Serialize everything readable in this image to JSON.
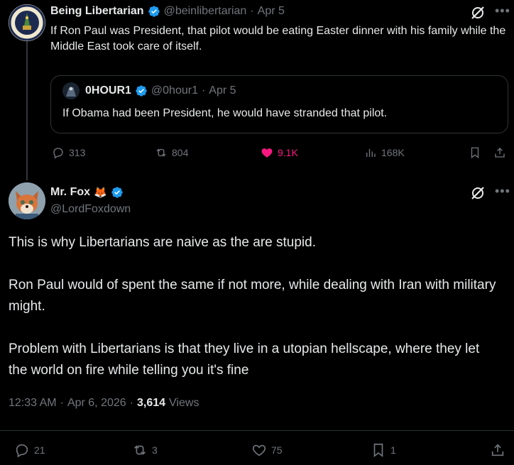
{
  "tweet1": {
    "name": "Being Libertarian",
    "handle": "@beinlibertarian",
    "sep": "·",
    "date": "Apr 5",
    "text": "If Ron Paul was President, that pilot would be eating Easter dinner with his family while the Middle East took care of itself.",
    "quote": {
      "name": "0HOUR1",
      "handle": "@0hour1",
      "sep": "·",
      "date": "Apr 5",
      "text": "If Obama had been President, he would have stranded that pilot."
    },
    "actions": {
      "replies": "313",
      "reposts": "804",
      "likes": "9.1K",
      "views": "168K"
    }
  },
  "tweet2": {
    "name": "Mr. Fox",
    "emoji": "🦊",
    "handle": "@LordFoxdown",
    "paragraphs": [
      "This is why Libertarians are naive as the are stupid.",
      "Ron Paul would of spent the same if not more, while dealing with Iran with military might.",
      "Problem with Libertarians is that they live in a utopian hellscape, where they let the world on fire while telling you it's fine"
    ],
    "time": "12:33 AM",
    "sep1": "·",
    "date": "Apr 6, 2026",
    "sep2": "·",
    "views_count": "3,614",
    "views_label": "Views",
    "actions": {
      "replies": "21",
      "reposts": "3",
      "likes": "75",
      "bookmarks": "1"
    }
  },
  "colors": {
    "background": "#000000",
    "text": "#e7e9ea",
    "muted": "#71767b",
    "verified": "#1d9bf0",
    "like": "#f91880",
    "border": "#2f3336"
  }
}
